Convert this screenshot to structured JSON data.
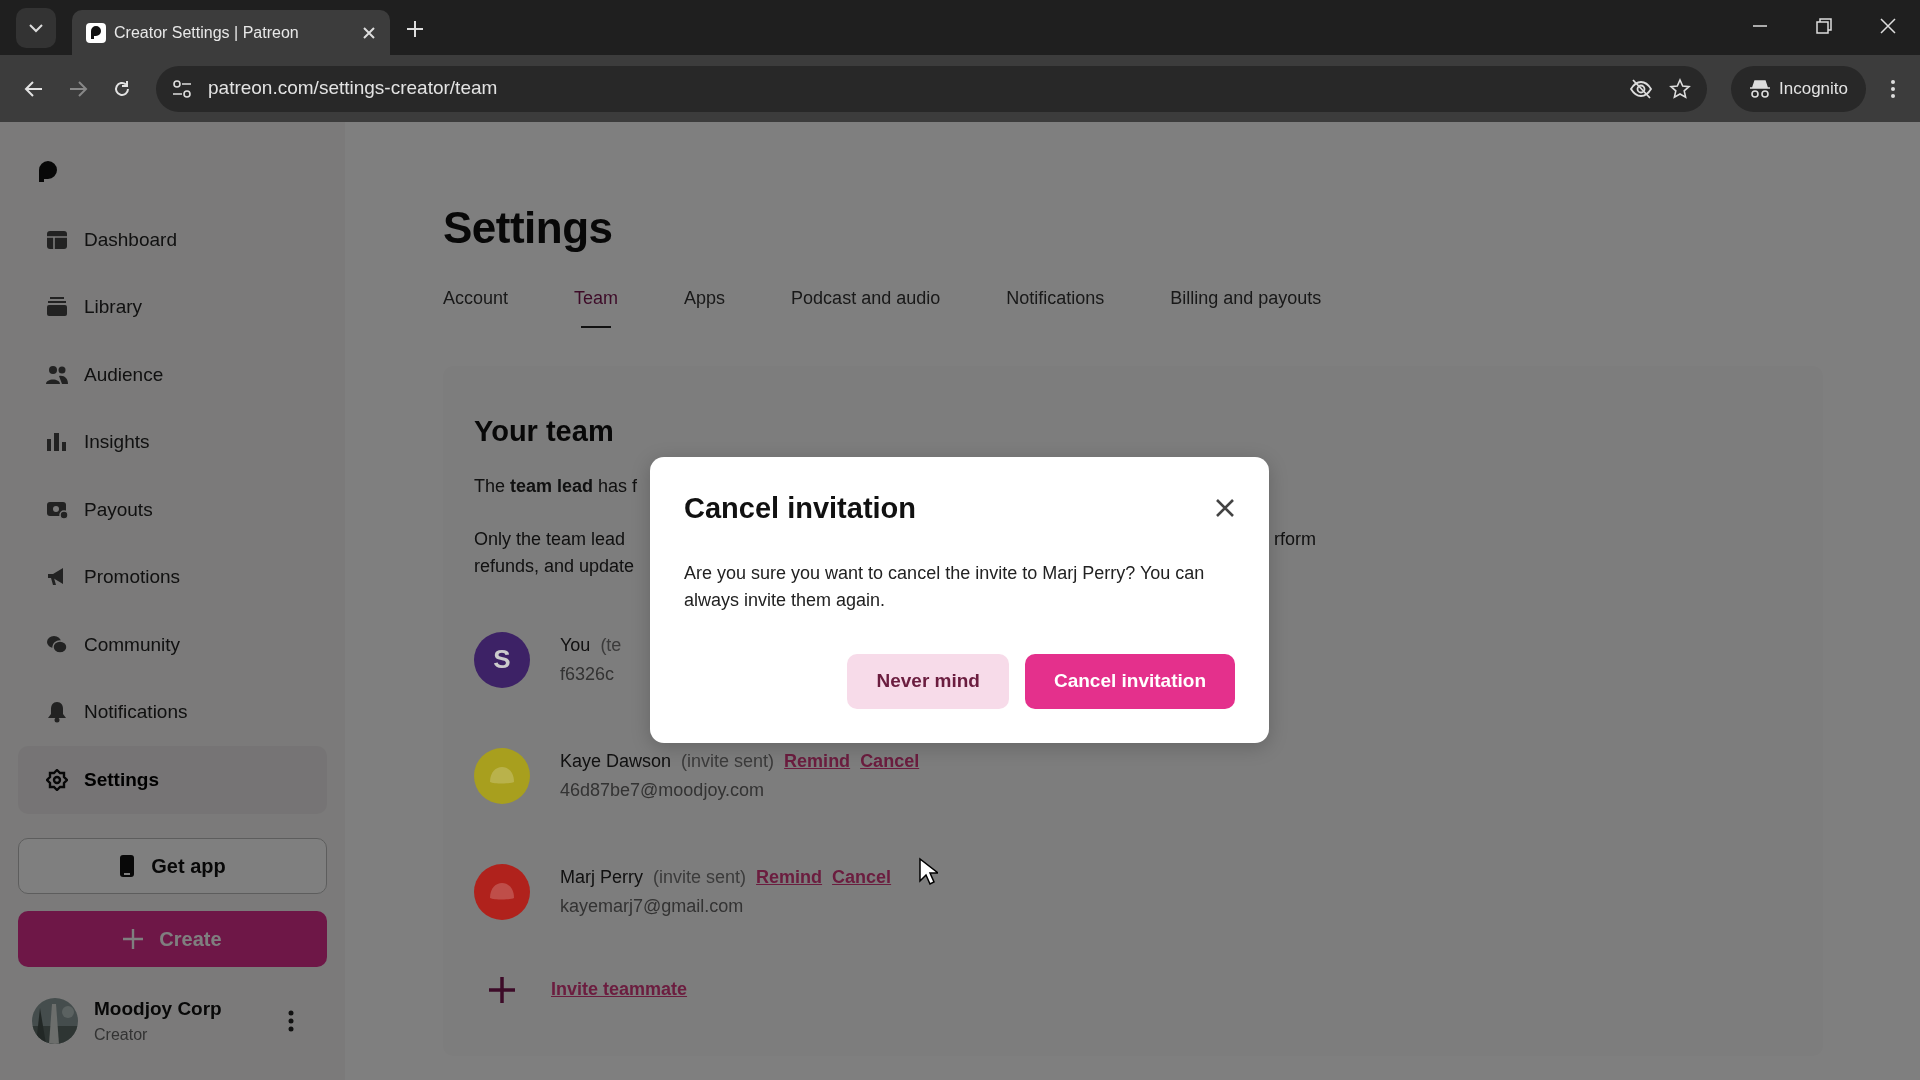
{
  "browser": {
    "tab_title": "Creator Settings | Patreon",
    "url": "patreon.com/settings-creator/team",
    "profile_label": "Incognito"
  },
  "sidebar": {
    "items": [
      {
        "label": "Dashboard",
        "selected": false
      },
      {
        "label": "Library",
        "selected": false
      },
      {
        "label": "Audience",
        "selected": false
      },
      {
        "label": "Insights",
        "selected": false
      },
      {
        "label": "Payouts",
        "selected": false
      },
      {
        "label": "Promotions",
        "selected": false
      },
      {
        "label": "Community",
        "selected": false
      },
      {
        "label": "Notifications",
        "selected": false
      },
      {
        "label": "Settings",
        "selected": true
      }
    ],
    "get_app": "Get app",
    "create": "Create",
    "profile": {
      "name": "Moodjoy Corp",
      "role": "Creator"
    }
  },
  "page": {
    "title": "Settings",
    "tabs": [
      {
        "label": "Account",
        "selected": false
      },
      {
        "label": "Team",
        "selected": true
      },
      {
        "label": "Apps",
        "selected": false
      },
      {
        "label": "Podcast and audio",
        "selected": false
      },
      {
        "label": "Notifications",
        "selected": false
      },
      {
        "label": "Billing and payouts",
        "selected": false
      }
    ],
    "section_title": "Your team",
    "intro": [
      {
        "text": "The **team lead** has f"
      },
      {
        "text": "Only the team lead",
        "tail": "rform"
      },
      {
        "text": "refunds, and update"
      }
    ],
    "members": [
      {
        "name": "You",
        "status": "(te",
        "email": "f6326c",
        "avatar": {
          "kind": "letter",
          "initial": "S",
          "color": "#3d2266"
        }
      },
      {
        "name": "Kaye Dawson",
        "status": "(invite sent)",
        "actions": [
          "Remind",
          "Cancel"
        ],
        "email": "46d87be7@moodjoy.com",
        "avatar": {
          "kind": "blob",
          "color": "#a89f1e"
        }
      },
      {
        "name": "Marj Perry",
        "status": "(invite sent)",
        "actions": [
          "Remind",
          "Cancel"
        ],
        "email": "kayemarj7@gmail.com",
        "avatar": {
          "kind": "blob",
          "color": "#b0221c"
        }
      }
    ],
    "invite": "Invite teammate"
  },
  "modal": {
    "title": "Cancel invitation",
    "body": "Are you sure you want to cancel the invite to Marj Perry? You can always invite them again.",
    "buttons": [
      {
        "label": "Never mind",
        "kind": "secondary"
      },
      {
        "label": "Cancel invitation",
        "kind": "primary"
      }
    ]
  }
}
